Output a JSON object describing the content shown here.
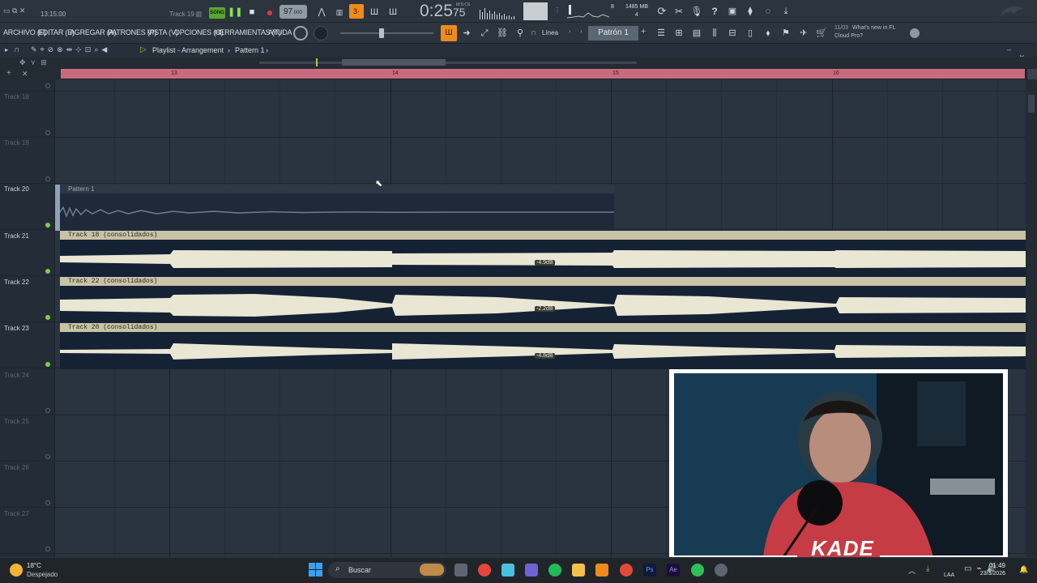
{
  "topbar": {
    "clock": "13:15:00",
    "hint_track": "Track 19",
    "song_label": "SONG",
    "tempo": "97",
    "tempo_decimal": ".000",
    "time_main": "0:25",
    "time_sub": "75",
    "time_unit": "M:S:CS",
    "cpu_voices": "8",
    "memory": "1485 MB",
    "poly": "4",
    "news_date": "11/03",
    "news_text_1": "What's new in FL",
    "news_text_2": "Cloud Pro?"
  },
  "menubar": {
    "items": [
      "ARCHIVO (F)",
      "EDITAR (E)",
      "AGREGAR (A)",
      "PATRONES (P)",
      "VISTA (V)",
      "OPCIONES (O)",
      "HERRAMIENTAS (T)",
      "AYUDA"
    ],
    "snap_mode": "Línea",
    "pattern_selector": "Patrón 1"
  },
  "playlist": {
    "title": "Playlist - Arrangement",
    "pattern": "Pattern 1",
    "bar_markers": [
      "13",
      "14",
      "15",
      "16"
    ]
  },
  "tracks": [
    {
      "name": "Track 18",
      "active": false
    },
    {
      "name": "Track 19",
      "active": false
    },
    {
      "name": "Track 20",
      "active": true
    },
    {
      "name": "Track 21",
      "active": true
    },
    {
      "name": "Track 22",
      "active": true
    },
    {
      "name": "Track 23",
      "active": true
    },
    {
      "name": "Track 24",
      "active": false
    },
    {
      "name": "Track 25",
      "active": false
    },
    {
      "name": "Track 26",
      "active": false
    },
    {
      "name": "Track 27",
      "active": false
    }
  ],
  "clips": {
    "pattern_clip": "Pattern 1",
    "clip_a": "Track 18 (consolidados)",
    "clip_a_gain": "-4.9dB",
    "clip_b": "Track 22 (consolidados)",
    "clip_b_gain": "-2.2dB",
    "clip_c": "Track 20 (consolidados)",
    "clip_c_gain": "-4.8dB"
  },
  "webcam": {
    "overlay_name": "KADE"
  },
  "taskbar": {
    "weather_temp": "18°C",
    "weather_desc": "Despejado",
    "search_placeholder": "Buscar",
    "language": "LAA",
    "time": "01:49",
    "date": "23/3/2026"
  },
  "colors": {
    "accent_orange": "#f08a1c",
    "timeline_pink": "#c96a7e",
    "clip_header": "#c8c2a6",
    "waveform": "#e9e6d4"
  }
}
